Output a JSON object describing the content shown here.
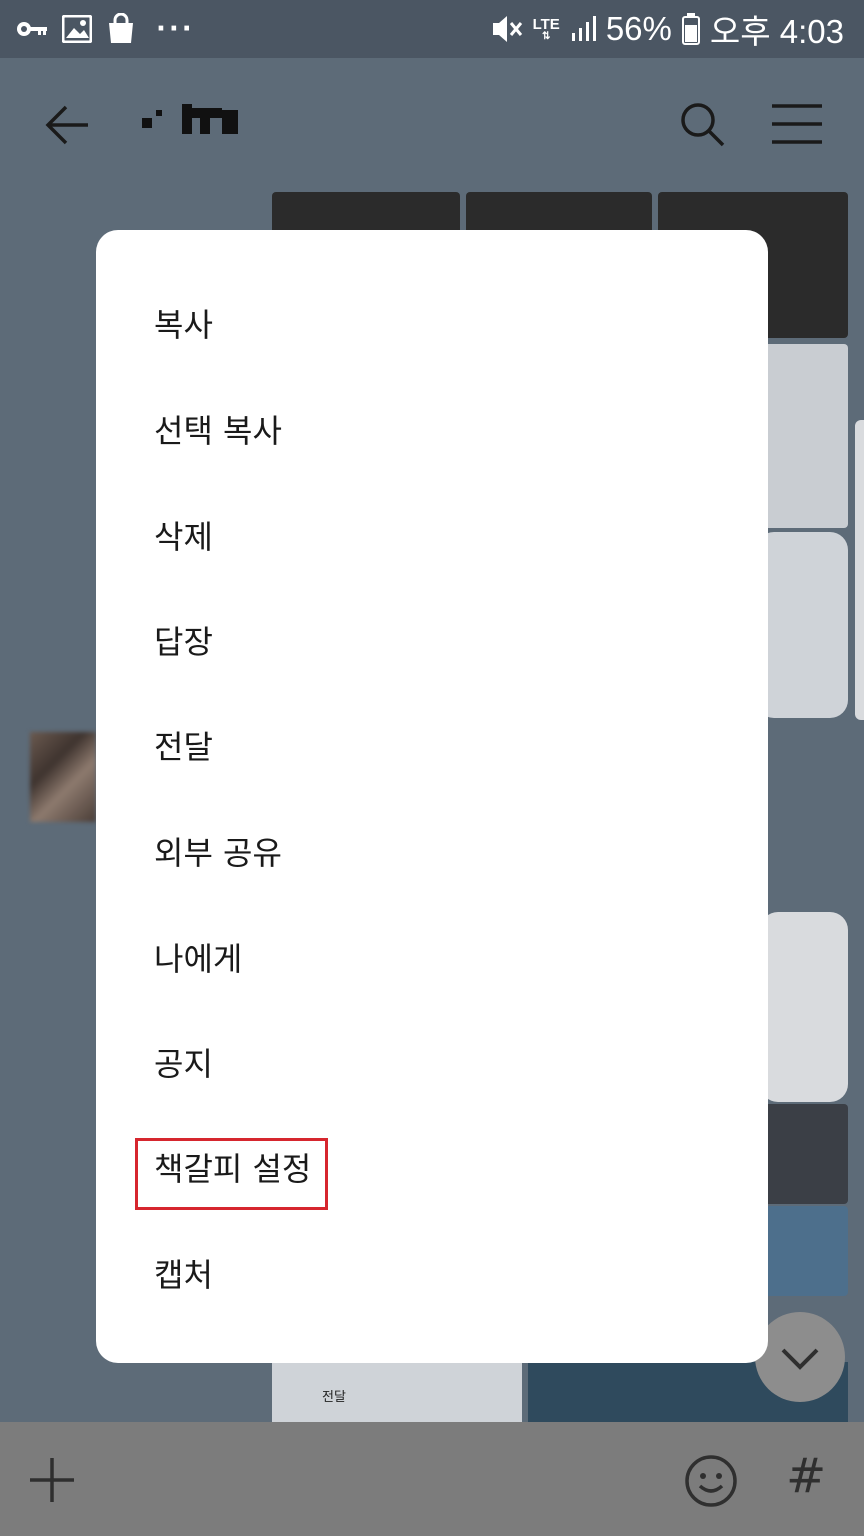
{
  "status_bar": {
    "battery_text": "56%",
    "time_text": "오후 4:03",
    "network_text": "LTE",
    "overflow_dots": "···",
    "icons": [
      "key-icon",
      "image-icon",
      "shopping-bag-icon",
      "vibrate-mute-icon",
      "signal-icon",
      "battery-icon"
    ]
  },
  "header": {
    "icons": [
      "back-arrow-icon",
      "search-icon",
      "hamburger-menu-icon"
    ]
  },
  "background_chat": {
    "snippet_text": "전달"
  },
  "context_menu": {
    "items": [
      {
        "label": "복사"
      },
      {
        "label": "선택 복사"
      },
      {
        "label": "삭제"
      },
      {
        "label": "답장"
      },
      {
        "label": "전달"
      },
      {
        "label": "외부 공유"
      },
      {
        "label": "나에게"
      },
      {
        "label": "공지"
      },
      {
        "label": "책갈피 설정",
        "highlighted": true
      },
      {
        "label": "캡처"
      }
    ],
    "highlight_color": "#d6262e"
  },
  "input_bar": {
    "hash_label": "#",
    "icons": [
      "plus-icon",
      "emoji-icon",
      "hash-icon"
    ]
  },
  "colors": {
    "overlay_bg": "#5d6b78",
    "menu_bg": "#ffffff",
    "text": "#1a1a1a"
  }
}
